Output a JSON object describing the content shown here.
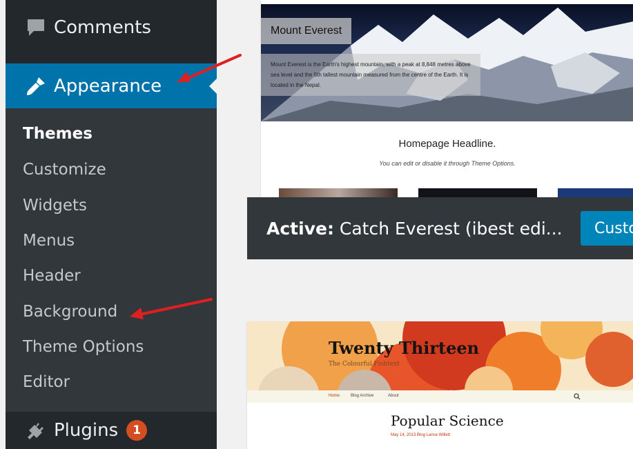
{
  "sidebar": {
    "comments_label": "Comments",
    "appearance_label": "Appearance",
    "plugins_label": "Plugins",
    "plugins_badge": "1",
    "submenu": [
      {
        "label": "Themes",
        "current": true
      },
      {
        "label": "Customize"
      },
      {
        "label": "Widgets"
      },
      {
        "label": "Menus"
      },
      {
        "label": "Header"
      },
      {
        "label": "Background"
      },
      {
        "label": "Theme Options"
      },
      {
        "label": "Editor"
      }
    ]
  },
  "active_theme": {
    "screenshot": {
      "hero_title": "Mount Everest",
      "hero_caption": "Mount Everest is the Earth's highest mountain, with a peak at 8,848 metres above sea level and the 5th tallest mountain measured from the centre of the Earth. It is located in the Nepal.",
      "headline": "Homepage Headline.",
      "subheadline": "You can edit or disable it through Theme Options."
    },
    "active_prefix": "Active:",
    "name": "Catch Everest (ibest edi...",
    "customize_label": "Custo"
  },
  "second_theme": {
    "title": "Twenty Thirteen",
    "tagline": "The Colourful Fishtext",
    "nav": [
      "Home",
      "Blog Archive",
      "About"
    ],
    "post_title": "Popular Science",
    "post_meta": "May 14, 2013   Blog   Lance Willett"
  },
  "colors": {
    "sidebar_bg": "#23282d",
    "submenu_bg": "#32373c",
    "accent_blue": "#0073aa",
    "button_blue": "#0085ba",
    "badge_orange": "#d54e21",
    "annotation_arrow": "#e02020"
  },
  "icons": {
    "comments": "speech-bubble-icon",
    "appearance": "paintbrush-icon",
    "plugins": "plug-icon",
    "search": "search-icon"
  }
}
